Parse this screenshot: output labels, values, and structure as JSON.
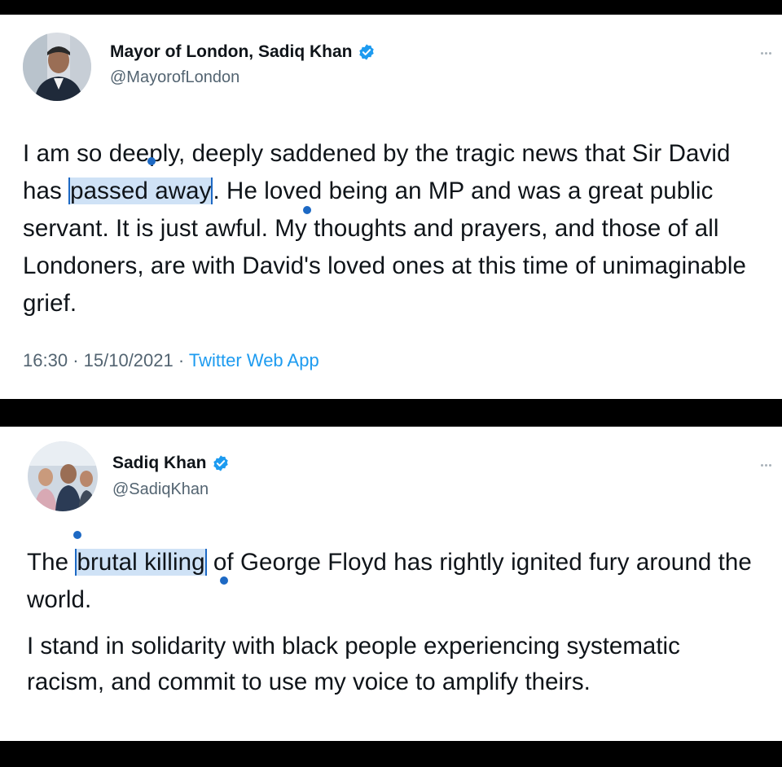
{
  "tweets": [
    {
      "display_name": "Mayor of London, Sadiq Khan",
      "handle": "@MayorofLondon",
      "text_before": "I am so deeply, deeply saddened by the tragic news that Sir David has ",
      "text_selected": "passed away",
      "text_after": ". He loved being an MP and was a great public servant. It is just awful. My thoughts and prayers, and those of all Londoners, are with David's loved ones at this time of unimaginable grief.",
      "time": "16:30",
      "date": "15/10/2021",
      "source": "Twitter Web App"
    },
    {
      "display_name": "Sadiq Khan",
      "handle": "@SadiqKhan",
      "text_before": "The ",
      "text_selected": "brutal killing",
      "text_after": " of George Floyd has rightly ignited fury around the world.",
      "text_para2": "I stand in solidarity with black people experiencing systematic racism, and commit to use my voice to amplify theirs."
    }
  ],
  "separator": "·",
  "icons": [
    "verified-badge-icon",
    "more-options-icon"
  ],
  "colors": {
    "selection": "#cfe2f6",
    "selection_handle": "#1d69c4",
    "link": "#1d9bf0",
    "secondary_text": "#536471",
    "verified": "#1d9bf0"
  }
}
